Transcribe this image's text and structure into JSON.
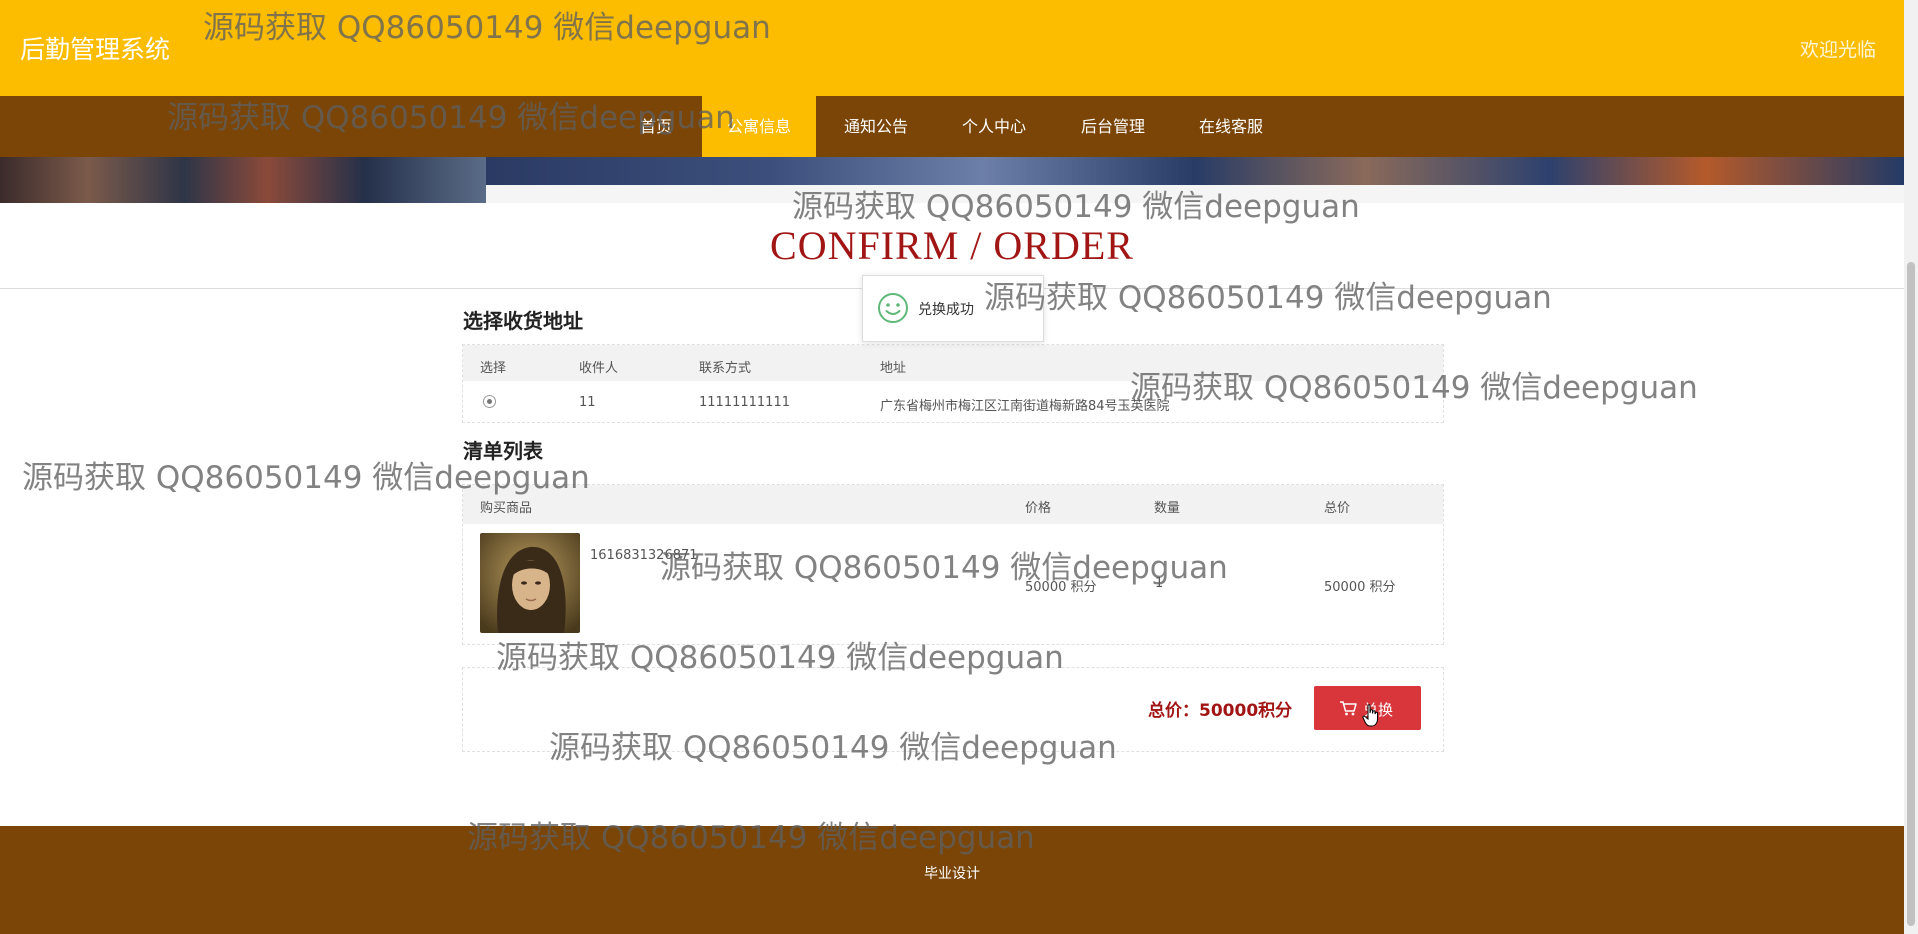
{
  "header": {
    "site_title": "后勤管理系统",
    "welcome": "欢迎光临"
  },
  "nav": {
    "items": [
      {
        "label": "首页"
      },
      {
        "label": "公寓信息"
      },
      {
        "label": "通知公告"
      },
      {
        "label": "个人中心"
      },
      {
        "label": "后台管理"
      },
      {
        "label": "在线客服"
      }
    ],
    "active_index": 1
  },
  "page": {
    "heading": "CONFIRM / ORDER"
  },
  "toast": {
    "text": "兑换成功",
    "icon": "smile-icon"
  },
  "address_section": {
    "title": "选择收货地址",
    "columns": [
      "选择",
      "收件人",
      "联系方式",
      "地址"
    ],
    "rows": [
      {
        "recipient": "11",
        "phone": "11111111111",
        "address": "广东省梅州市梅江区江南街道梅新路84号玉英医院",
        "selected": true
      }
    ]
  },
  "order_section": {
    "title": "清单列表",
    "columns": [
      "购买商品",
      "价格",
      "数量",
      "总价"
    ],
    "items": [
      {
        "name": "1616831326871",
        "price": "50000 积分",
        "quantity": "1",
        "total": "50000 积分"
      }
    ]
  },
  "summary": {
    "total_label": "总价：50000积分",
    "exchange_button": "兑换"
  },
  "footer": {
    "text": "毕业设计"
  },
  "watermark": {
    "text": "源码获取 QQ86050149 微信deepguan"
  },
  "colors": {
    "header_yellow": "#fcbd00",
    "nav_brown": "#7a4506",
    "accent_red": "#a21515",
    "button_red": "#d9363b"
  }
}
